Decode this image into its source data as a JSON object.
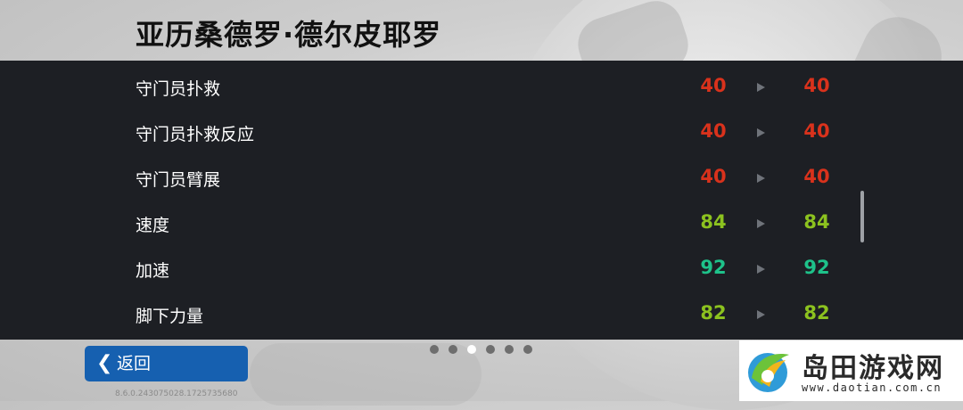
{
  "header": {
    "player_name": "亚历桑德罗·德尔皮耶罗"
  },
  "stats": [
    {
      "label": "守门员扑救",
      "current": "40",
      "next": "40",
      "color": "#d9321c"
    },
    {
      "label": "守门员扑救反应",
      "current": "40",
      "next": "40",
      "color": "#d9321c"
    },
    {
      "label": "守门员臂展",
      "current": "40",
      "next": "40",
      "color": "#d9321c"
    },
    {
      "label": "速度",
      "current": "84",
      "next": "84",
      "color": "#8cc21f"
    },
    {
      "label": "加速",
      "current": "92",
      "next": "92",
      "color": "#1ec28a"
    },
    {
      "label": "脚下力量",
      "current": "82",
      "next": "82",
      "color": "#8cc21f"
    }
  ],
  "pagination": {
    "total": 6,
    "active_index": 2
  },
  "footer": {
    "back_label": "返回",
    "version": "8.6.0.243075028.1725735680"
  },
  "watermark": {
    "name": "岛田游戏网",
    "url": "www.daotian.com.cn"
  },
  "colors": {
    "panel_bg": "#1d1f24",
    "back_button": "#1660b0",
    "stat_red": "#d9321c",
    "stat_yellow_green": "#8cc21f",
    "stat_green": "#1ec28a"
  },
  "icons": {
    "back": "chevron-left-icon",
    "arrow": "triangle-right-icon"
  }
}
